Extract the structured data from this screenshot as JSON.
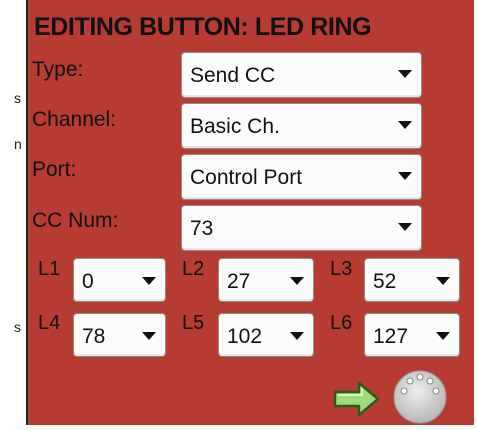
{
  "panel": {
    "title": "EDITING BUTTON: LED RING",
    "bg_color": "#b63b33"
  },
  "fields": {
    "type": {
      "label": "Type:",
      "value": "Send CC"
    },
    "channel": {
      "label": "Channel:",
      "value": "Basic Ch."
    },
    "port": {
      "label": "Port:",
      "value": "Control Port"
    },
    "cc_num": {
      "label": "CC Num:",
      "value": "73"
    }
  },
  "leds": [
    {
      "label": "L1",
      "value": "0"
    },
    {
      "label": "L2",
      "value": "27"
    },
    {
      "label": "L3",
      "value": "52"
    },
    {
      "label": "L4",
      "value": "78"
    },
    {
      "label": "L5",
      "value": "102"
    },
    {
      "label": "L6",
      "value": "127"
    }
  ],
  "edge_marks": [
    "s",
    "n",
    "s"
  ],
  "icons": {
    "next": "right-arrow-icon",
    "connector": "midi-din-connector-icon"
  }
}
